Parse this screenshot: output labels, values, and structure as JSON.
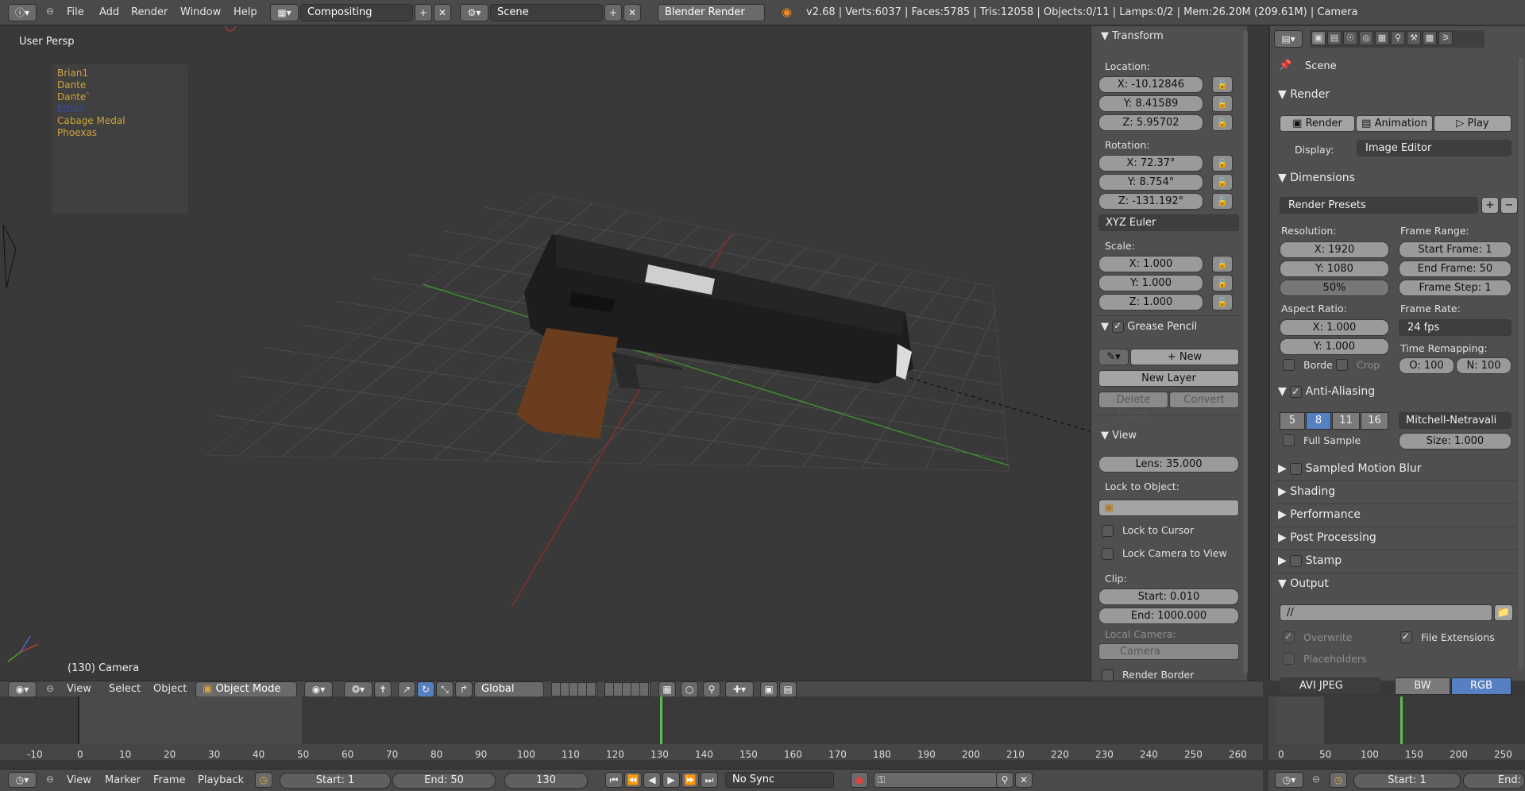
{
  "topbar": {
    "menus": [
      "File",
      "Add",
      "Render",
      "Window",
      "Help"
    ],
    "layout": "Compositing",
    "scene": "Scene",
    "engine": "Blender Render",
    "stats": "v2.68 | Verts:6037 | Faces:5785 | Tris:12058 | Objects:0/11 | Lamps:0/2 | Mem:26.20M (209.61M) | Camera"
  },
  "viewport": {
    "view_label": "User Persp",
    "object_label": "(130) Camera",
    "outliner_items": [
      "Brian1",
      "Dante",
      "Dante`",
      "Ethan",
      "Cabage Medal",
      "Phoexas"
    ]
  },
  "npanel": {
    "transform_title": "Transform",
    "location_label": "Location:",
    "location": [
      "X: -10.12846",
      "Y: 8.41589",
      "Z: 5.95702"
    ],
    "rotation_label": "Rotation:",
    "rotation": [
      "X: 72.37°",
      "Y: 8.754°",
      "Z: -131.192°"
    ],
    "rotation_mode": "XYZ Euler",
    "scale_label": "Scale:",
    "scale": [
      "X: 1.000",
      "Y: 1.000",
      "Z: 1.000"
    ],
    "grease_title": "Grease Pencil",
    "new_label": "New",
    "new_layer": "New Layer",
    "delete_frame": "Delete Frame",
    "convert": "Convert",
    "view_title": "View",
    "lens": "Lens: 35.000",
    "lock_to_object": "Lock to Object:",
    "lock_to_cursor": "Lock to Cursor",
    "lock_camera": "Lock Camera to View",
    "clip_label": "Clip:",
    "clip_start": "Start: 0.010",
    "clip_end": "End: 1000.000",
    "local_camera": "Local Camera:",
    "camera": "Camera",
    "render_border": "Render Border"
  },
  "props": {
    "scene": "Scene",
    "render_title": "Render",
    "render_btn": "Render",
    "animation_btn": "Animation",
    "play_btn": "Play",
    "display_label": "Display:",
    "display_value": "Image Editor",
    "dimensions_title": "Dimensions",
    "render_presets": "Render Presets",
    "resolution_label": "Resolution:",
    "res_x": "X: 1920",
    "res_y": "Y: 1080",
    "res_pct": "50%",
    "frame_range_label": "Frame Range:",
    "start_frame": "Start Frame: 1",
    "end_frame": "End Frame: 50",
    "frame_step": "Frame Step: 1",
    "aspect_label": "Aspect Ratio:",
    "aspect_x": "X: 1.000",
    "aspect_y": "Y: 1.000",
    "frame_rate_label": "Frame Rate:",
    "frame_rate": "24 fps",
    "time_remap_label": "Time Remapping:",
    "remap_o": "O: 100",
    "remap_n": "N: 100",
    "border": "Borde",
    "crop": "Crop",
    "aa_title": "Anti-Aliasing",
    "aa_samples": [
      "5",
      "8",
      "11",
      "16"
    ],
    "aa_filter": "Mitchell-Netravali",
    "full_sample": "Full Sample",
    "aa_size": "Size: 1.000",
    "collapsed": [
      "Sampled Motion Blur",
      "Shading",
      "Performance",
      "Post Processing",
      "Stamp"
    ],
    "output_title": "Output",
    "output_path": "//",
    "overwrite": "Overwrite",
    "file_ext": "File Extensions",
    "placeholders": "Placeholders",
    "format": "AVI JPEG",
    "bw": "BW",
    "rgb": "RGB"
  },
  "viewheader": {
    "menus": [
      "View",
      "Select",
      "Object"
    ],
    "mode": "Object Mode",
    "orientation": "Global"
  },
  "timeline": {
    "ticks": [
      "-10",
      "0",
      "10",
      "20",
      "30",
      "40",
      "50",
      "60",
      "70",
      "80",
      "90",
      "100",
      "110",
      "120",
      "130",
      "140",
      "150",
      "160",
      "170",
      "180",
      "190",
      "200",
      "210",
      "220",
      "230",
      "240",
      "250",
      "260"
    ],
    "ticks2": [
      "0",
      "50",
      "100",
      "150",
      "200",
      "250"
    ],
    "menus": [
      "View",
      "Marker",
      "Frame",
      "Playback"
    ],
    "start": "Start: 1",
    "end": "End: 50",
    "current": "130",
    "sync": "No Sync",
    "start2": "Start: 1",
    "end2": "End:"
  }
}
